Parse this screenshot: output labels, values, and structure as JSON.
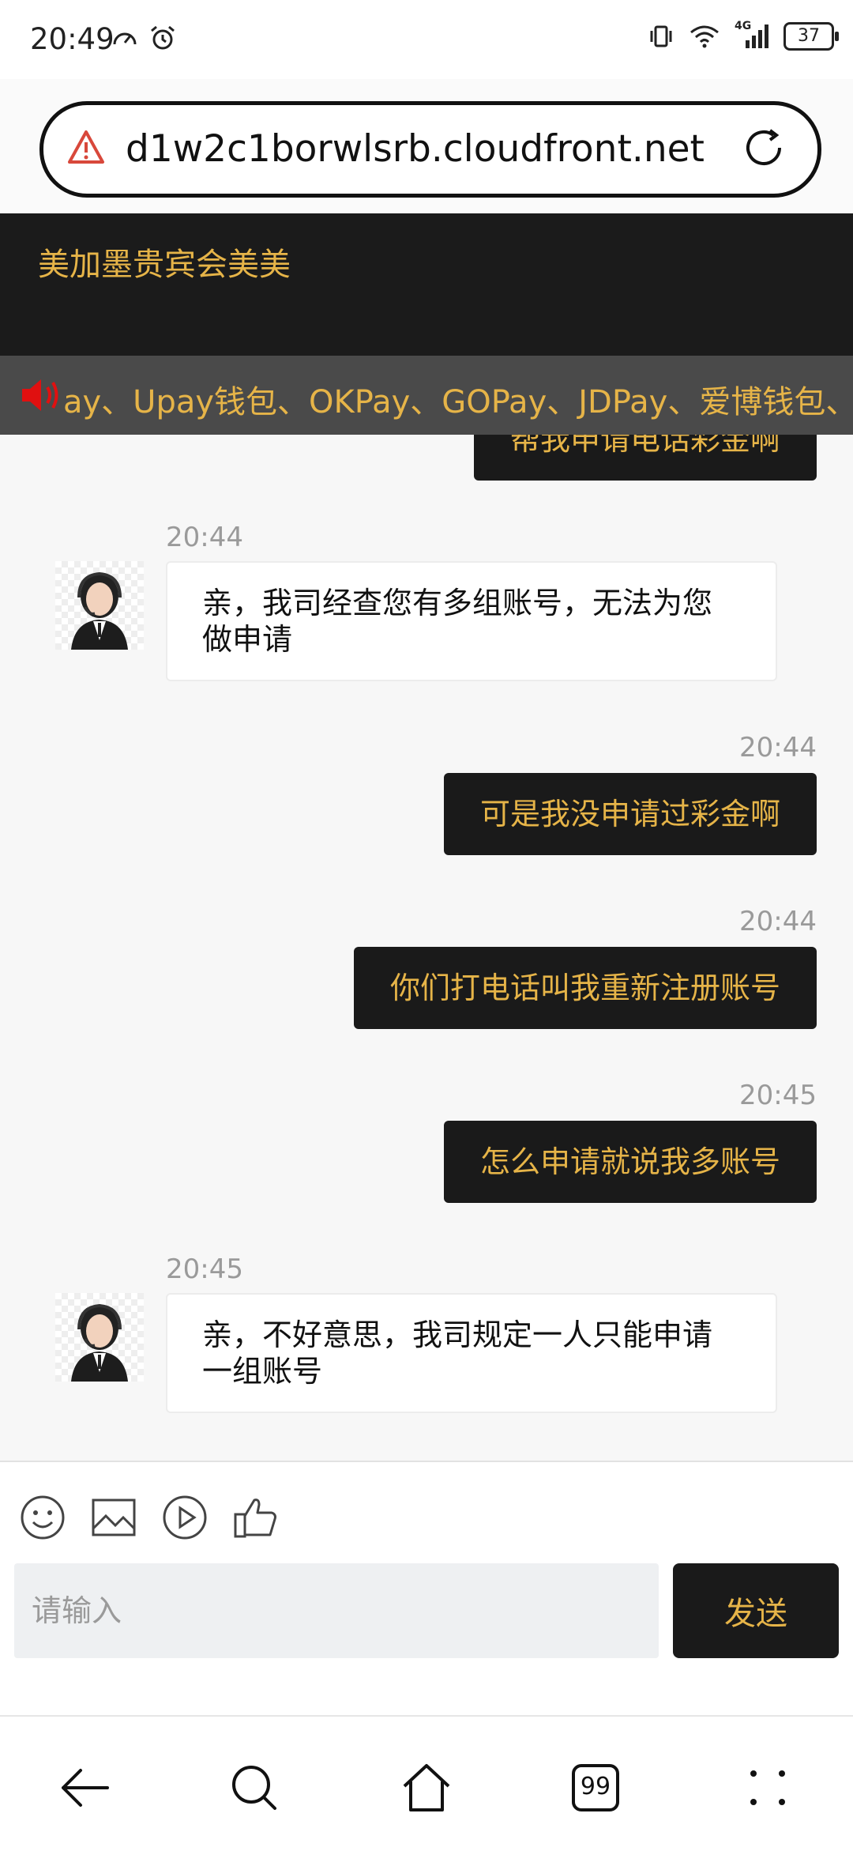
{
  "status_bar": {
    "time": "20:49",
    "battery": "37",
    "network": "4G"
  },
  "browser": {
    "url": "d1w2c1borwlsrb.cloudfront.net"
  },
  "header": {
    "title": "美加墨贵宾会美美"
  },
  "marquee": {
    "text": "ay、Upay钱包、OKPay、GOPay、JDPay、爱博钱包、C"
  },
  "chat": {
    "partial_message": "帮我申请电话彩金啊",
    "messages": [
      {
        "side": "left",
        "time": "20:44",
        "text": "亲，我司经查您有多组账号，无法为您做申请"
      },
      {
        "side": "right",
        "time": "20:44",
        "text": "可是我没申请过彩金啊"
      },
      {
        "side": "right",
        "time": "20:44",
        "text": "你们打电话叫我重新注册账号"
      },
      {
        "side": "right",
        "time": "20:45",
        "text": "怎么申请就说我多账号"
      },
      {
        "side": "left",
        "time": "20:45",
        "text": "亲，不好意思，我司规定一人只能申请一组账号"
      }
    ]
  },
  "composer": {
    "placeholder": "请输入",
    "send_label": "发送",
    "icons": [
      "emoji-icon",
      "image-icon",
      "video-icon",
      "thumbs-up-icon"
    ]
  },
  "bottom_nav": {
    "tab_count": "99",
    "icons": [
      "back-icon",
      "search-icon",
      "home-icon",
      "tabs-icon",
      "menu-icon"
    ]
  },
  "colors": {
    "accent": "#e6b448",
    "dark": "#1a1a1a",
    "marquee_bg": "#4a4a4a"
  }
}
